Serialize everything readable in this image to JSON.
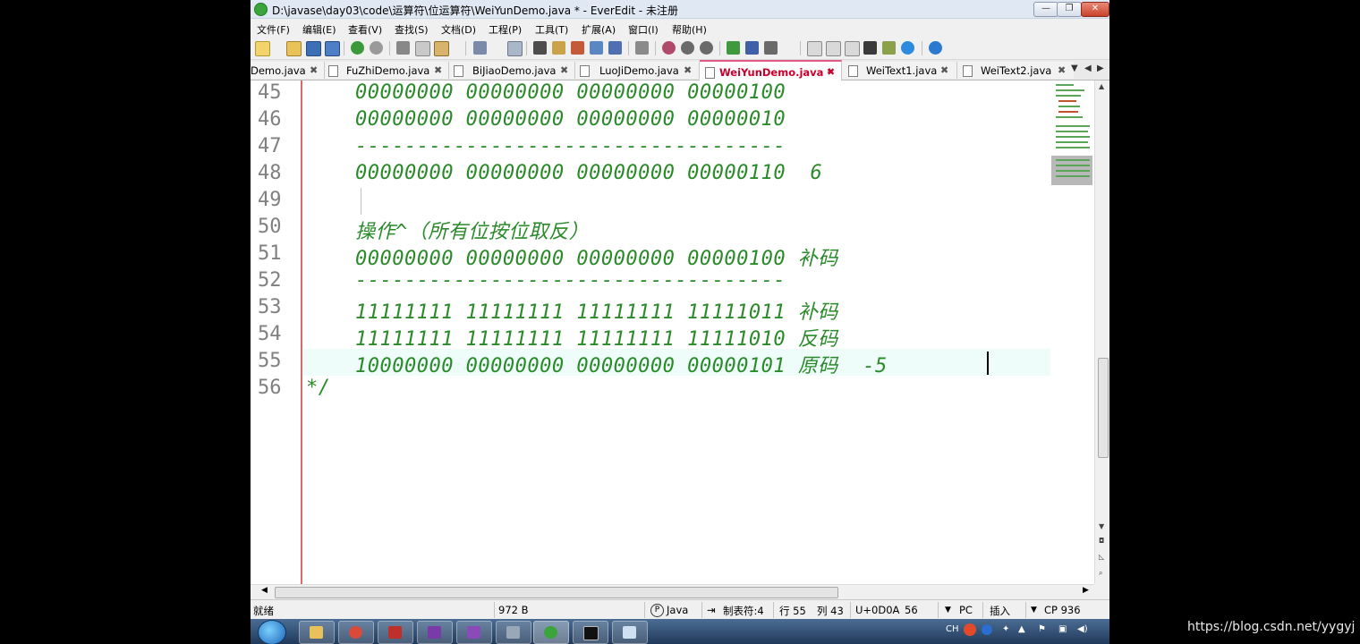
{
  "window": {
    "title": "D:\\javase\\day03\\code\\运算符\\位运算符\\WeiYunDemo.java * - EverEdit - 未注册",
    "buttons": [
      "minimize",
      "restore",
      "close"
    ]
  },
  "menu": [
    "文件(F)",
    "编辑(E)",
    "查看(V)",
    "查找(S)",
    "文档(D)",
    "工程(P)",
    "工具(T)",
    "扩展(A)",
    "窗口(I)",
    "帮助(H)"
  ],
  "tabs": [
    {
      "label": "Demo.java",
      "active": false
    },
    {
      "label": "FuZhiDemo.java",
      "active": false
    },
    {
      "label": "BiJiaoDemo.java",
      "active": false
    },
    {
      "label": "LuoJiDemo.java",
      "active": false
    },
    {
      "label": "WeiYunDemo.java *",
      "active": true
    },
    {
      "label": "WeiText1.java",
      "active": false
    },
    {
      "label": "WeiText2.java",
      "active": false
    }
  ],
  "editor": {
    "lines": [
      {
        "n": "45",
        "text": "    00000000 00000000 00000000 00000100"
      },
      {
        "n": "46",
        "text": "    00000000 00000000 00000000 00000010"
      },
      {
        "n": "47",
        "text": "    -----------------------------------"
      },
      {
        "n": "48",
        "text": "    00000000 00000000 00000000 00000110  6"
      },
      {
        "n": "49",
        "text": ""
      },
      {
        "n": "50",
        "text": "    操作^（所有位按位取反）"
      },
      {
        "n": "51",
        "text": "    00000000 00000000 00000000 00000100 补码"
      },
      {
        "n": "52",
        "text": "    -----------------------------------"
      },
      {
        "n": "53",
        "text": "    11111111 11111111 11111111 11111011 补码"
      },
      {
        "n": "54",
        "text": "    11111111 11111111 11111111 11111010 反码"
      },
      {
        "n": "55",
        "text": "    10000000 00000000 00000000 00000101 原码  -5"
      },
      {
        "n": "56",
        "text": "*/"
      }
    ]
  },
  "status": {
    "ready": "就绪",
    "size": "972 B",
    "language": "Java",
    "tab_mode": "制表符:4",
    "row": "行 55",
    "col": "列 43",
    "char_code": "U+0D0A",
    "char_dec": "56",
    "line_ending": "PC",
    "insert_mode": "插入",
    "encoding": "CP 936"
  },
  "taskbar": {
    "tray_lang": "CH"
  },
  "watermark": "https://blog.csdn.net/yygyj"
}
